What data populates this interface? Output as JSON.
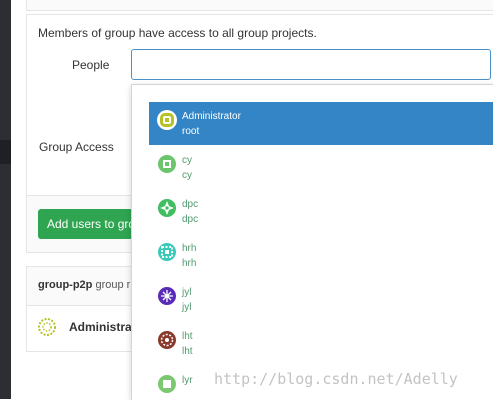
{
  "form": {
    "info_text": "Members of group have access to all group projects.",
    "people_label": "People",
    "people_value": "",
    "access_label": "Group Access",
    "add_button_label": "Add users to grou"
  },
  "members_panel": {
    "group_name": "group-p2p",
    "heading_suffix": "group r",
    "member_name": "Administrat"
  },
  "dropdown": {
    "options": [
      {
        "name": "Administrator",
        "username": "root",
        "highlighted": true,
        "avatar_color": "#b5c224"
      },
      {
        "name": "cy",
        "username": "cy",
        "highlighted": false,
        "avatar_color": "#6cc46f"
      },
      {
        "name": "dpc",
        "username": "dpc",
        "highlighted": false,
        "avatar_color": "#3fbf5f"
      },
      {
        "name": "hrh",
        "username": "hrh",
        "highlighted": false,
        "avatar_color": "#38c9b7"
      },
      {
        "name": "jyl",
        "username": "jyl",
        "highlighted": false,
        "avatar_color": "#5a2bb8"
      },
      {
        "name": "lht",
        "username": "lht",
        "highlighted": false,
        "avatar_color": "#8a3a2c"
      },
      {
        "name": "lyr",
        "username": "",
        "highlighted": false,
        "avatar_color": "#7bc870"
      }
    ]
  },
  "watermark": "http://blog.csdn.net/Adelly",
  "colors": {
    "highlight": "#3385c6",
    "button": "#2fa552",
    "sidebar": "#2c2e33"
  }
}
